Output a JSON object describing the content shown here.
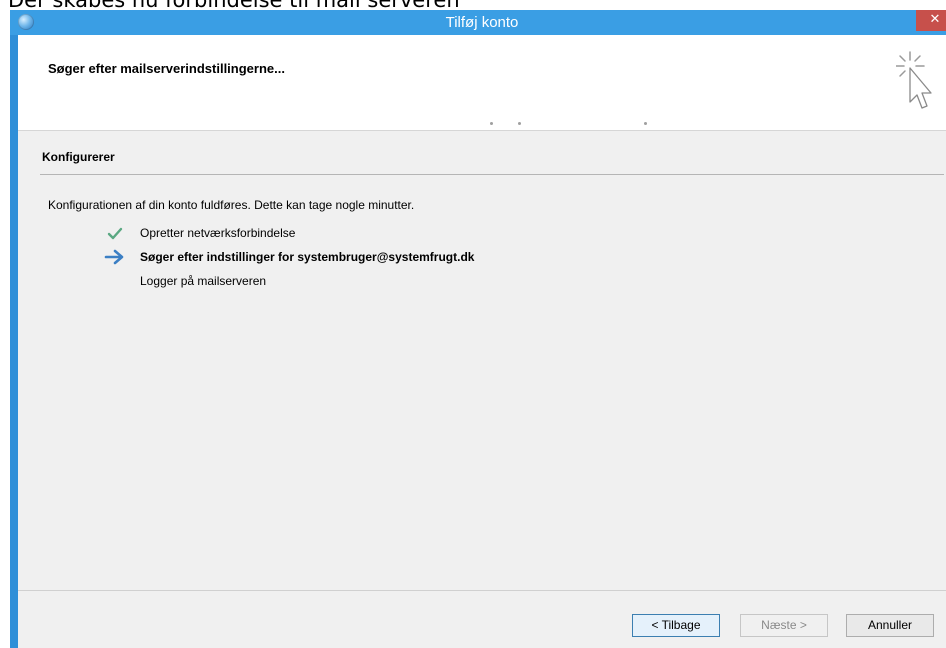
{
  "caption": "Der skabes nu forbindelse til mail serveren",
  "window": {
    "title": "Tilføj konto",
    "close_symbol": "✕"
  },
  "header": {
    "title": "Søger efter mailserverindstillingerne..."
  },
  "section": {
    "heading": "Konfigurerer",
    "description": "Konfigurationen af din konto fuldføres. Dette kan tage nogle minutter."
  },
  "steps": [
    {
      "label": "Opretter netværksforbindelse",
      "status": "done",
      "icon": "checkmark-icon"
    },
    {
      "label": "Søger efter indstillinger for systembruger@systemfrugt.dk",
      "status": "current",
      "icon": "arrow-right-icon"
    },
    {
      "label": "Logger på mailserveren",
      "status": "pending",
      "icon": ""
    }
  ],
  "buttons": {
    "back": "< Tilbage",
    "next": "Næste >",
    "cancel": "Annuller"
  },
  "colors": {
    "titlebar": "#3a9ee4",
    "close": "#c7504b",
    "check": "#5aa882",
    "arrow": "#3b7fc4"
  }
}
